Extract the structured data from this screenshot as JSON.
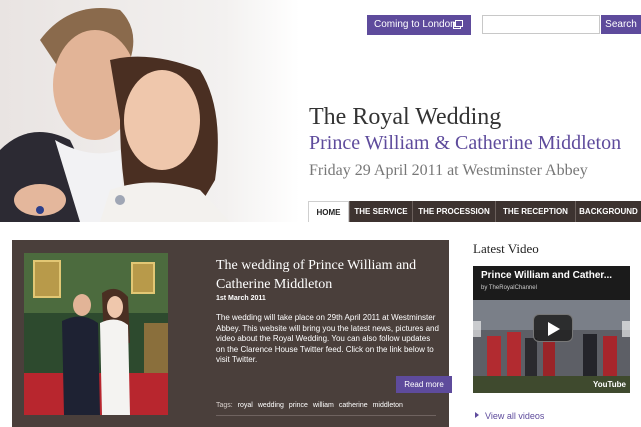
{
  "header": {
    "coming_button": "Coming to London?",
    "search": {
      "placeholder": "",
      "button": "Search"
    },
    "title": "The Royal Wedding",
    "subtitle": "Prince William & Catherine Middleton",
    "date_line": "Friday 29 April 2011 at Westminster Abbey"
  },
  "nav": {
    "active": "HOME",
    "tabs": [
      "HOME",
      "THE SERVICE",
      "THE PROCESSION",
      "THE RECEPTION",
      "BACKGROUND"
    ]
  },
  "article": {
    "title": "The wedding of Prince William and Catherine Middleton",
    "date": "1st March 2011",
    "body": "The wedding will take place on 29th April 2011 at Westminster Abbey. This website will bring you the latest news, pictures and video about the Royal Wedding. You can also follow updates on the Clarence House Twitter feed. Click on the link below to visit Twitter.",
    "read_more": "Read more",
    "tags_label": "Tags:",
    "tags": [
      "royal",
      "wedding",
      "prince",
      "william",
      "catherine",
      "middleton"
    ]
  },
  "sidebar": {
    "heading": "Latest Video",
    "video": {
      "title": "Prince William and Cather...",
      "channel": "by TheRoyalChannel",
      "logo": "YouTube"
    },
    "view_all": "View all videos"
  },
  "colors": {
    "brand_purple": "#5e4b9c",
    "nav_dark": "#3d3330",
    "panel_brown": "#4a3f3b"
  },
  "icons": {
    "coming_button": "external-window-icon",
    "video_play": "play-icon",
    "view_all": "arrow-right-icon"
  }
}
